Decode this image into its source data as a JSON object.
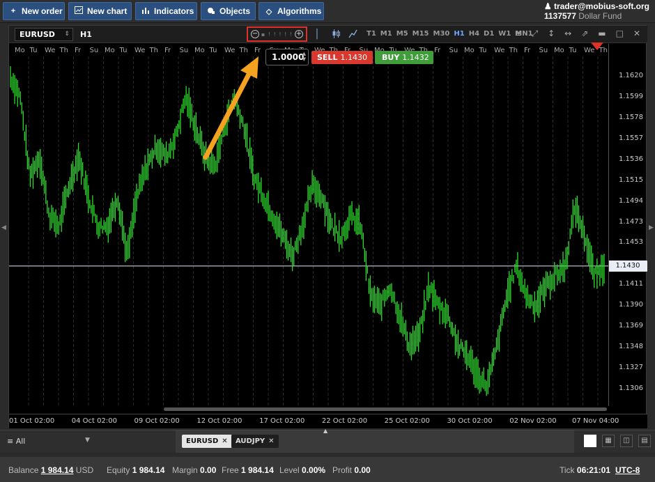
{
  "toolbar": {
    "new_order": "New order",
    "new_chart": "New chart",
    "indicators": "Indicators",
    "objects": "Objects",
    "algorithms": "Algorithms"
  },
  "account": {
    "user": "trader@mobius-soft.org",
    "id": "1137577",
    "fund": "Dollar Fund"
  },
  "chart": {
    "symbol": "EURUSD",
    "timeframe": "H1",
    "timeframes": [
      "T1",
      "M1",
      "M5",
      "M15",
      "M30",
      "H1",
      "H4",
      "D1",
      "W1",
      "MN1"
    ],
    "active_timeframe": "H1",
    "quantity": "1.0000",
    "sell_label": "SELL",
    "sell_price": "1.1430",
    "buy_label": "BUY",
    "buy_price": "1.1432",
    "current_price": "1.1430",
    "day_labels": [
      "Mo",
      "Tu",
      "We",
      "Th",
      "Fr",
      "Su",
      "Mo",
      "Tu",
      "We",
      "Th",
      "Fr",
      "Su",
      "Mo",
      "Tu",
      "We",
      "Th",
      "Fr",
      "Su",
      "Mo",
      "Tu",
      "We",
      "Th",
      "Fr",
      "Su",
      "Mo",
      "Tu",
      "We",
      "Th",
      "Fr",
      "Su",
      "Mo",
      "Tu",
      "We",
      "Th",
      "Fr",
      "Su",
      "Mo",
      "Tu",
      "We",
      "Th"
    ],
    "y_ticks": [
      "1.1620",
      "1.1599",
      "1.1578",
      "1.1557",
      "1.1536",
      "1.1515",
      "1.1494",
      "1.1473",
      "1.1453",
      "1.1411",
      "1.1390",
      "1.1369",
      "1.1348",
      "1.1327",
      "1.1306"
    ],
    "x_ticks": [
      "01 Oct 02:00",
      "04 Oct 02:00",
      "09 Oct 02:00",
      "12 Oct 02:00",
      "17 Oct 02:00",
      "22 Oct 02:00",
      "25 Oct 02:00",
      "30 Oct 02:00",
      "02 Nov 02:00",
      "07 Nov 04:00"
    ]
  },
  "chart_data": {
    "type": "line",
    "title": "",
    "xlabel": "",
    "ylabel": "",
    "ylim": [
      1.1295,
      1.1632
    ],
    "x": [
      "01 Oct 02:00",
      "04 Oct 02:00",
      "09 Oct 02:00",
      "12 Oct 02:00",
      "17 Oct 02:00",
      "22 Oct 02:00",
      "25 Oct 02:00",
      "30 Oct 02:00",
      "02 Nov 02:00",
      "07 Nov 04:00"
    ],
    "series": [
      {
        "values": [
          1.162,
          1.16,
          1.152,
          1.154,
          1.148,
          1.147,
          1.151,
          1.154,
          1.15,
          1.147,
          1.147,
          1.15,
          1.144,
          1.15,
          1.153,
          1.155,
          1.154,
          1.156,
          1.16,
          1.157,
          1.154,
          1.153,
          1.157,
          1.16,
          1.157,
          1.152,
          1.15,
          1.148,
          1.146,
          1.144,
          1.147,
          1.151,
          1.15,
          1.147,
          1.146,
          1.148,
          1.147,
          1.14,
          1.139,
          1.141,
          1.138,
          1.135,
          1.136,
          1.141,
          1.139,
          1.138,
          1.135,
          1.134,
          1.132,
          1.131,
          1.135,
          1.14,
          1.143,
          1.14,
          1.139,
          1.141,
          1.142,
          1.143,
          1.149,
          1.146,
          1.142,
          1.143
        ]
      }
    ],
    "grid": true,
    "color": "#2edc2e"
  },
  "tabs": {
    "filter": "All",
    "items": [
      "EURUSD",
      "AUDJPY"
    ]
  },
  "status": {
    "balance_label": "Balance",
    "balance": "1 984.14",
    "currency": "USD",
    "equity_label": "Equity",
    "equity": "1 984.14",
    "margin_label": "Margin",
    "margin": "0.00",
    "free_label": "Free",
    "free": "1 984.14",
    "level_label": "Level",
    "level": "0.00%",
    "profit_label": "Profit",
    "profit": "0.00",
    "tick_label": "Tick",
    "tick": "06:21:01",
    "timezone": "UTC-8"
  },
  "colors": {
    "accent_button": "#2b5080",
    "sell": "#d9382f",
    "buy": "#3f9e3a",
    "candle": "#2edc2e",
    "highlight_box": "#e0302a",
    "annotation_arrow": "#f4a21f"
  }
}
